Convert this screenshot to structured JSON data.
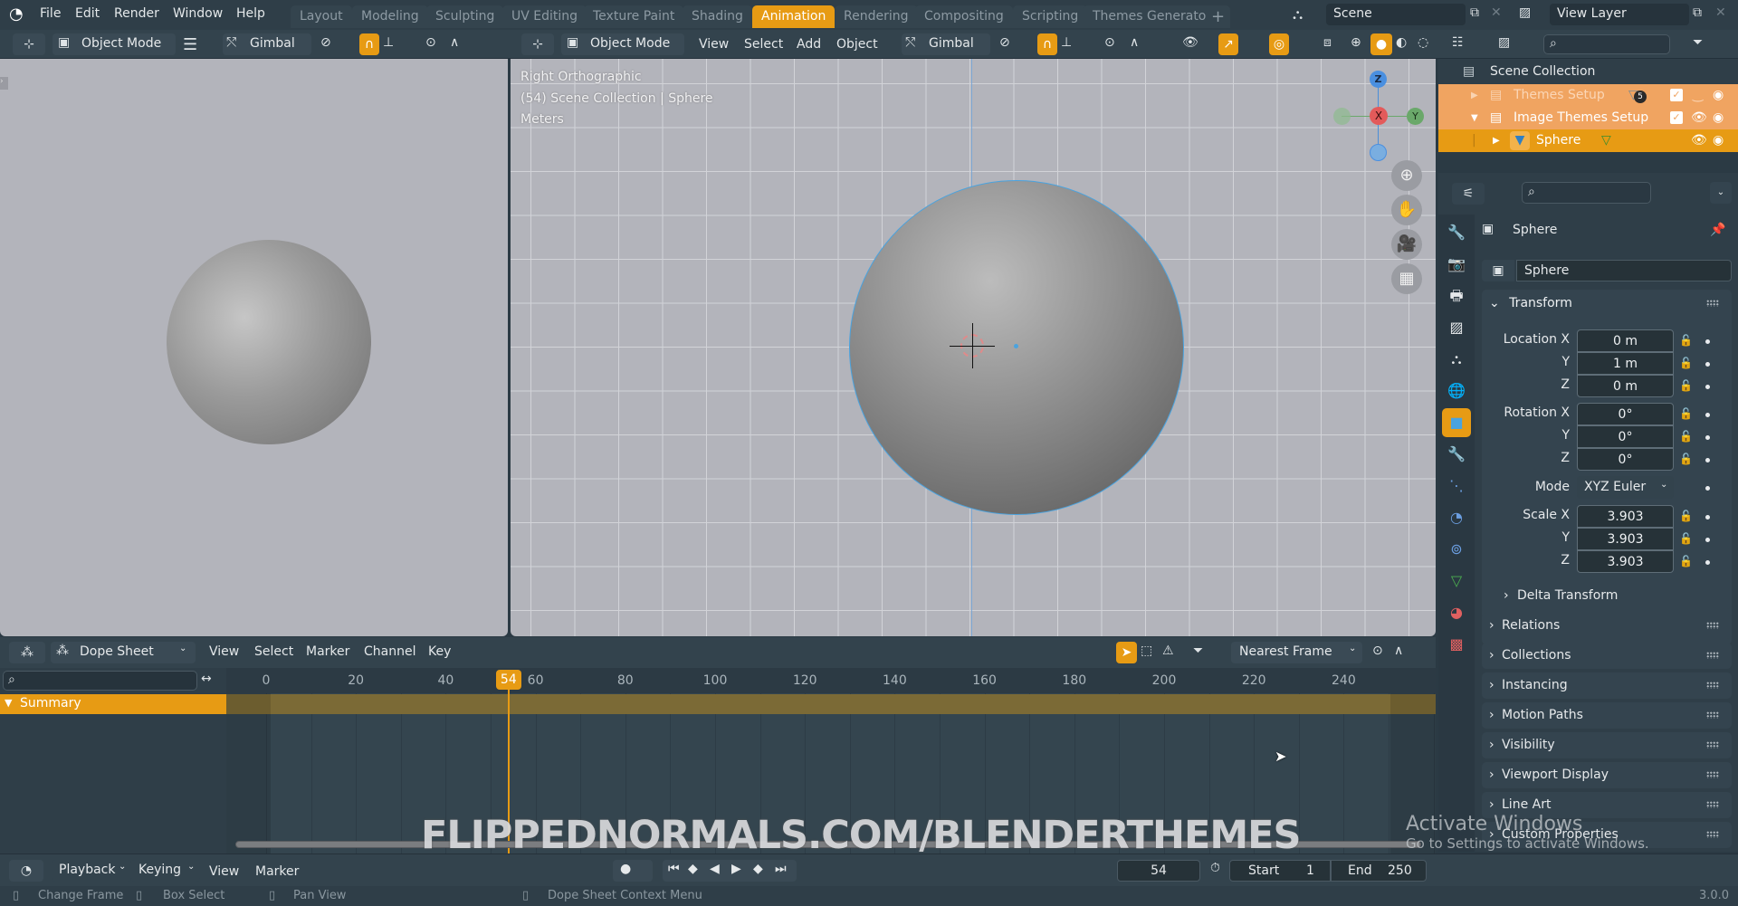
{
  "app": {
    "version": "3.0.0"
  },
  "menu": {
    "items": [
      "File",
      "Edit",
      "Render",
      "Window",
      "Help"
    ]
  },
  "workspaces": {
    "tabs": [
      "Layout",
      "Modeling",
      "Sculpting",
      "UV Editing",
      "Texture Paint",
      "Shading",
      "Animation",
      "Rendering",
      "Compositing",
      "Scripting",
      "Themes Generator"
    ],
    "active": "Animation",
    "add_label": "+"
  },
  "scene_selector": {
    "value": "Scene"
  },
  "view_layer_selector": {
    "value": "View Layer"
  },
  "left_toolbar": {
    "mode": "Object Mode",
    "orientation": "Gimbal"
  },
  "right_toolbar": {
    "mode": "Object Mode",
    "menus": [
      "View",
      "Select",
      "Add",
      "Object"
    ],
    "orientation": "Gimbal"
  },
  "viewport": {
    "overlay_lines": [
      "Right Orthographic",
      "(54) Scene Collection | Sphere",
      "Meters"
    ],
    "gizmo_axes": {
      "z": "Z",
      "x": "X",
      "y": "Y"
    },
    "nav_buttons": [
      "zoom",
      "pan",
      "camera",
      "ortho-toggle"
    ]
  },
  "outliner": {
    "search_placeholder": "",
    "root": "Scene Collection",
    "rows": [
      {
        "label": "Themes Setup",
        "badge": "5",
        "checked": true,
        "expanded": false
      },
      {
        "label": "Image Themes Setup",
        "checked": true,
        "expanded": true
      },
      {
        "label": "Sphere",
        "selected": true
      }
    ]
  },
  "properties": {
    "search_placeholder": "",
    "object_name": "Sphere",
    "datablock_name": "Sphere",
    "transform": {
      "title": "Transform",
      "location": {
        "label": "Location X",
        "x": "0 m",
        "y": "1 m",
        "z": "0 m"
      },
      "rotation": {
        "label": "Rotation X",
        "x": "0°",
        "y": "0°",
        "z": "0°"
      },
      "mode": {
        "label": "Mode",
        "value": "XYZ Euler"
      },
      "scale": {
        "label": "Scale X",
        "x": "3.903",
        "y": "3.903",
        "z": "3.903"
      },
      "axis_y": "Y",
      "axis_z": "Z",
      "delta": "Delta Transform"
    },
    "panels": [
      "Relations",
      "Collections",
      "Instancing",
      "Motion Paths",
      "Visibility",
      "Viewport Display",
      "Line Art",
      "Custom Properties"
    ]
  },
  "dopesheet": {
    "editor_type": "Dope Sheet",
    "menus": [
      "View",
      "Select",
      "Marker",
      "Channel",
      "Key"
    ],
    "snap": "Nearest Frame",
    "search_placeholder": "",
    "summary_label": "Summary",
    "current_frame": "54",
    "ruler_ticks": [
      "0",
      "20",
      "40",
      "60",
      "80",
      "100",
      "120",
      "140",
      "160",
      "180",
      "200",
      "220",
      "240"
    ]
  },
  "timeline": {
    "menus": [
      "Playback",
      "Keying",
      "View",
      "Marker"
    ],
    "current_frame": "54",
    "start_label": "Start",
    "start": "1",
    "end_label": "End",
    "end": "250"
  },
  "statusbar": {
    "hints": [
      "Change Frame",
      "Box Select",
      "Pan View",
      "Dope Sheet Context Menu"
    ]
  },
  "overlay": {
    "watermark": "FLIPPEDNORMALS.COM/BLENDERTHEMES",
    "activate_title": "Activate Windows",
    "activate_sub": "Go to Settings to activate Windows."
  },
  "colors": {
    "accent": "#e79b14",
    "bg": "#2f3e48",
    "viewport": "#b3b4bb",
    "selection_outline": "#4aa3df"
  }
}
